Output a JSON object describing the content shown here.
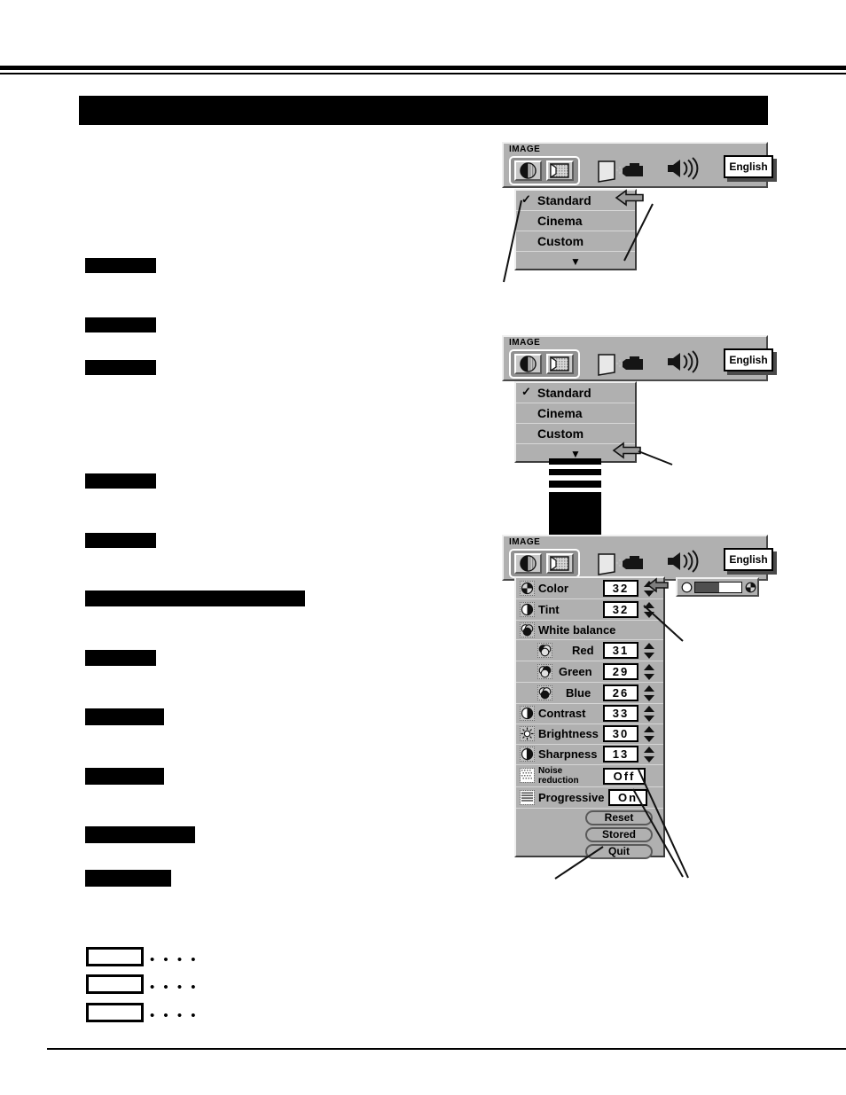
{
  "page": {
    "background": "#ffffff",
    "rules": {
      "color": "#000000"
    }
  },
  "redactions": {
    "header_banner": {
      "label": "redacted-heading-banner"
    },
    "body_bars": [
      {
        "label": "redacted-text-bar"
      },
      {
        "label": "redacted-text-bar"
      },
      {
        "label": "redacted-text-bar"
      },
      {
        "label": "redacted-text-bar"
      },
      {
        "label": "redacted-text-bar"
      },
      {
        "label": "redacted-text-bar"
      },
      {
        "label": "redacted-text-bar"
      },
      {
        "label": "redacted-text-bar"
      },
      {
        "label": "redacted-text-bar"
      },
      {
        "label": "redacted-text-bar"
      },
      {
        "label": "redacted-text-bar"
      }
    ],
    "legend_rows": [
      {
        "box": "",
        "dots": "• • • •"
      },
      {
        "box": "",
        "dots": "• • • •"
      },
      {
        "box": "",
        "dots": "• • • •"
      }
    ]
  },
  "osd_menu_1": {
    "title": "IMAGE",
    "toolbar": {
      "tabs": [
        {
          "icon": "contrast-icon",
          "selected": true
        },
        {
          "icon": "image-screen-icon",
          "selected": true
        }
      ],
      "projector_icon": "projector-icon",
      "sound_icon": "speaker-icon",
      "language_label": "English"
    },
    "items": [
      {
        "label": "Standard",
        "checked": true
      },
      {
        "label": "Cinema",
        "checked": false
      },
      {
        "label": "Custom",
        "checked": false
      },
      {
        "label": "▼",
        "checked": false
      }
    ]
  },
  "osd_menu_2": {
    "title": "IMAGE",
    "toolbar": {
      "language_label": "English"
    },
    "items": [
      {
        "label": "Standard",
        "checked": true
      },
      {
        "label": "Cinema",
        "checked": false
      },
      {
        "label": "Custom",
        "checked": false
      },
      {
        "label": "▼",
        "checked": false
      }
    ]
  },
  "osd_adjust": {
    "title": "IMAGE",
    "toolbar": {
      "language_label": "English"
    },
    "rows": [
      {
        "icon": "color-icon",
        "label": "Color",
        "value": "32",
        "indent": 0,
        "control": "spinner"
      },
      {
        "icon": "tint-icon",
        "label": "Tint",
        "value": "32",
        "indent": 0,
        "control": "spinner"
      },
      {
        "icon": "whitebalance-icon",
        "label": "White balance",
        "value": "",
        "indent": 0,
        "control": "none"
      },
      {
        "icon": "red-icon",
        "label": "Red",
        "value": "31",
        "indent": 1,
        "control": "spinner"
      },
      {
        "icon": "green-icon",
        "label": "Green",
        "value": "29",
        "indent": 1,
        "control": "spinner"
      },
      {
        "icon": "blue-icon",
        "label": "Blue",
        "value": "26",
        "indent": 1,
        "control": "spinner"
      },
      {
        "icon": "contrast-icon",
        "label": "Contrast",
        "value": "33",
        "indent": 0,
        "control": "spinner"
      },
      {
        "icon": "brightness-icon",
        "label": "Brightness",
        "value": "30",
        "indent": 0,
        "control": "spinner"
      },
      {
        "icon": "sharpness-icon",
        "label": "Sharpness",
        "value": "13",
        "indent": 0,
        "control": "spinner"
      },
      {
        "icon": "noise-icon",
        "label": "Noise\nreduction",
        "value": "Off",
        "indent": 0,
        "control": "toggle"
      },
      {
        "icon": "progressive-icon",
        "label": "Progressive",
        "value": "On",
        "indent": 0,
        "control": "toggle"
      }
    ],
    "noise_label_line1": "Noise",
    "noise_label_line2": "reduction",
    "buttons": [
      {
        "label": "Reset"
      },
      {
        "label": "Stored"
      },
      {
        "label": "Quit"
      }
    ],
    "slider": {
      "icon_left": "circle-icon",
      "icon_right": "contrast-pie-icon",
      "fill_percent": 52
    }
  }
}
